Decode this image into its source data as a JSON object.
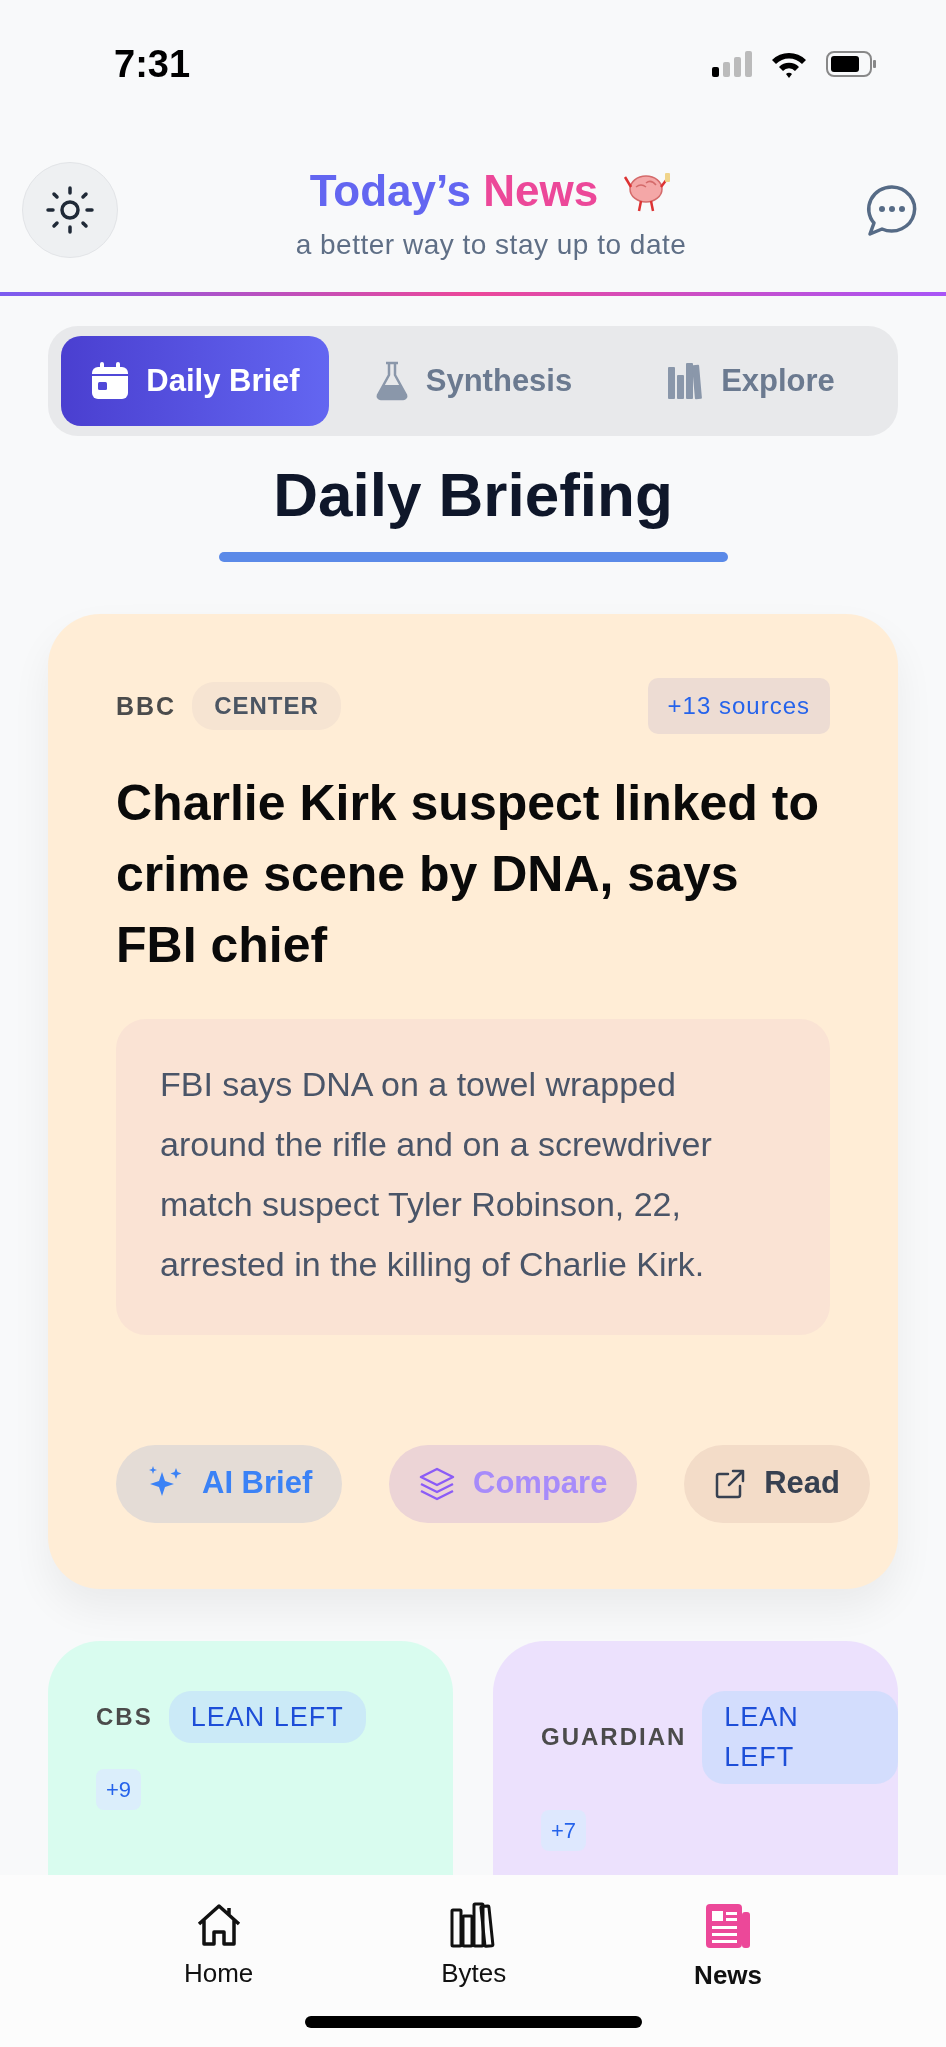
{
  "status_bar": {
    "time": "7:31"
  },
  "header": {
    "title_words": [
      {
        "text": "Today’s"
      },
      {
        "text": "News"
      }
    ],
    "subtitle": "a better way to stay up to date"
  },
  "tabs": [
    {
      "label": "Daily Brief",
      "selected": true
    },
    {
      "label": "Synthesis",
      "selected": false
    },
    {
      "label": "Explore",
      "selected": false
    }
  ],
  "section_title": "Daily Briefing",
  "featured": {
    "source": "BBC",
    "bias": "CENTER",
    "sources_count": "+13 sources",
    "headline": "Charlie Kirk suspect linked to crime scene by DNA, says FBI chief",
    "summary": "FBI says DNA on a towel wrapped around the rifle and on a screwdriver match suspect Tyler Robinson, 22, arrested in the killing of Charlie Kirk.",
    "actions": [
      {
        "kind": "brief",
        "label": "AI Brief"
      },
      {
        "kind": "compare",
        "label": "Compare"
      },
      {
        "kind": "read",
        "label": "Read"
      }
    ]
  },
  "cards": [
    {
      "source": "CBS",
      "bias": "LEAN LEFT",
      "count": "+9",
      "color": "#d9fcef"
    },
    {
      "source": "GUARDIAN",
      "bias": "LEAN LEFT",
      "count": "+7",
      "color": "#ece1fd"
    }
  ],
  "bottom_nav": [
    {
      "label": "Home",
      "selected": false
    },
    {
      "label": "Bytes",
      "selected": false
    },
    {
      "label": "News",
      "selected": true
    }
  ]
}
